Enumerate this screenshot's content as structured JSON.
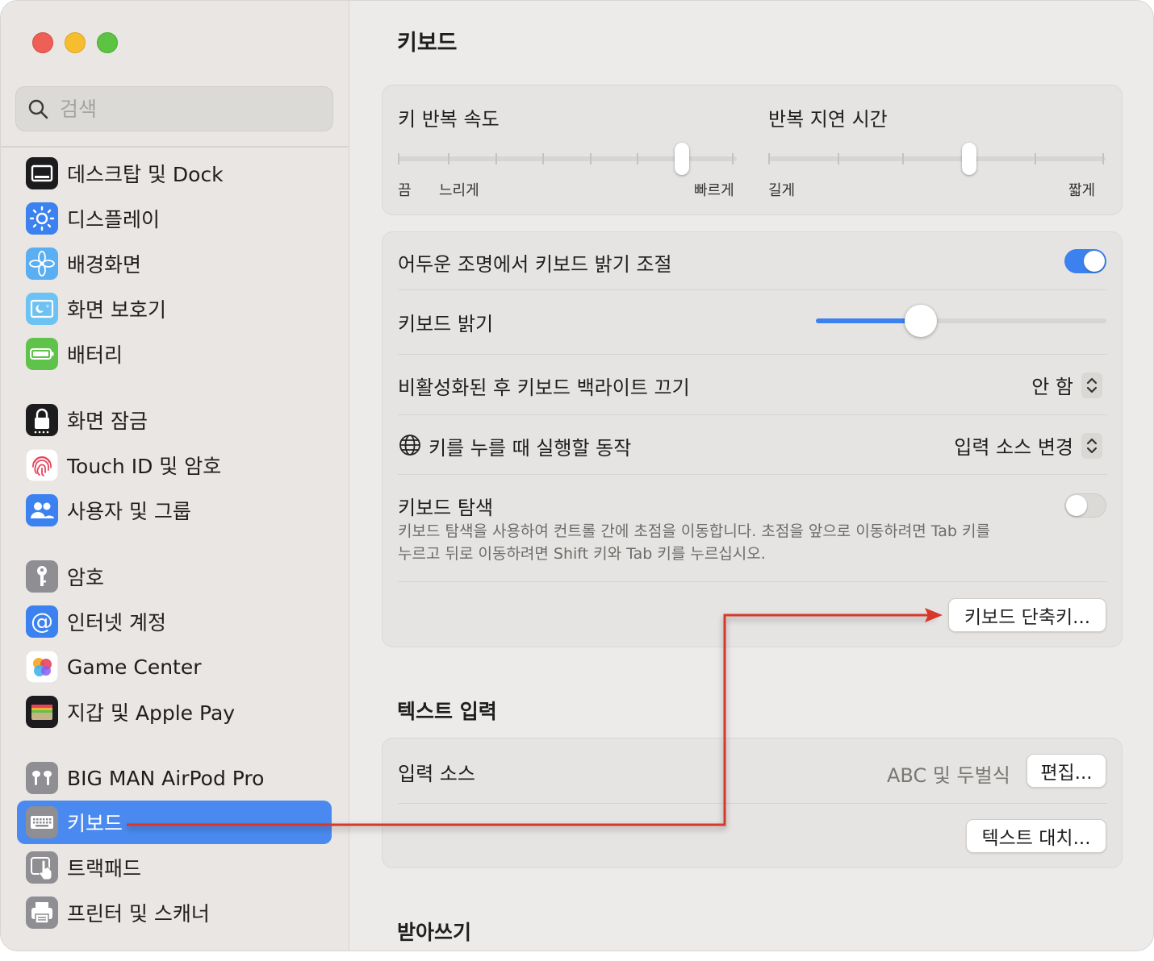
{
  "window": {
    "title": "키보드"
  },
  "search": {
    "placeholder": "검색"
  },
  "sidebar": {
    "items": [
      {
        "label": "데스크탑 및 Dock",
        "icon": "dock-icon",
        "color": "#1c1c1e"
      },
      {
        "label": "디스플레이",
        "icon": "display-sun-icon",
        "color": "#3b82f0"
      },
      {
        "label": "배경화면",
        "icon": "wallpaper-flower-icon",
        "color": "#5aaef2"
      },
      {
        "label": "화면 보호기",
        "icon": "screensaver-icon",
        "color": "#6cc3f3"
      },
      {
        "label": "배터리",
        "icon": "battery-icon",
        "color": "#5fc34b"
      },
      {
        "label": "화면 잠금",
        "icon": "lock-icon",
        "color": "#1c1c1e"
      },
      {
        "label": "Touch ID 및 암호",
        "icon": "fingerprint-icon",
        "color": "#ffffff"
      },
      {
        "label": "사용자 및 그룹",
        "icon": "users-icon",
        "color": "#3b82f0"
      },
      {
        "label": "암호",
        "icon": "key-icon",
        "color": "#8e8e93"
      },
      {
        "label": "인터넷 계정",
        "icon": "at-sign-icon",
        "color": "#3b82f0"
      },
      {
        "label": "Game Center",
        "icon": "game-center-icon",
        "color": "#ffffff"
      },
      {
        "label": "지갑 및 Apple Pay",
        "icon": "wallet-icon",
        "color": "#1c1c1e"
      },
      {
        "label": "BIG MAN AirPod Pro",
        "icon": "airpods-icon",
        "color": "#8e8e93"
      },
      {
        "label": "키보드",
        "icon": "keyboard-icon",
        "color": "#8e8e93",
        "selected": true
      },
      {
        "label": "트랙패드",
        "icon": "trackpad-icon",
        "color": "#8e8e93"
      },
      {
        "label": "프린터 및 스캐너",
        "icon": "printer-icon",
        "color": "#8e8e93"
      }
    ]
  },
  "main": {
    "title": "키보드",
    "repeat": {
      "rate_label": "키 반복 속도",
      "rate_labels": [
        "끔",
        "느리게",
        "빠르게"
      ],
      "rate_value_step": 7,
      "rate_steps": 8,
      "delay_label": "반복 지연 시간",
      "delay_labels": [
        "길게",
        "짧게"
      ],
      "delay_value_step": 4,
      "delay_steps": 6
    },
    "backlight_auto": {
      "label": "어두운 조명에서 키보드 밝기 조절",
      "on": true
    },
    "brightness": {
      "label": "키보드 밝기",
      "value": 0.36
    },
    "backlight_off": {
      "label": "비활성화된 후 키보드 백라이트 끄기",
      "value": "안 함"
    },
    "globe_key": {
      "label": "키를 누를 때 실행할 동작",
      "value": "입력 소스 변경"
    },
    "nav": {
      "label": "키보드 탐색",
      "on": false,
      "desc1": "키보드 탐색을 사용하여 컨트롤 간에 초점을 이동합니다. 초점을 앞으로 이동하려면 Tab 키를",
      "desc2": "누르고 뒤로 이동하려면 Shift 키와 Tab 키를 누르십시오."
    },
    "shortcuts_button": "키보드 단축키...",
    "text_input": {
      "title": "텍스트 입력",
      "sources_label": "입력 소스",
      "sources_value": "ABC 및 두벌식",
      "edit_button": "편집...",
      "replacements_button": "텍스트 대치..."
    },
    "dictation_title": "받아쓰기"
  },
  "colors": {
    "accent": "#3b82f0",
    "annotation": "#d8382c"
  }
}
